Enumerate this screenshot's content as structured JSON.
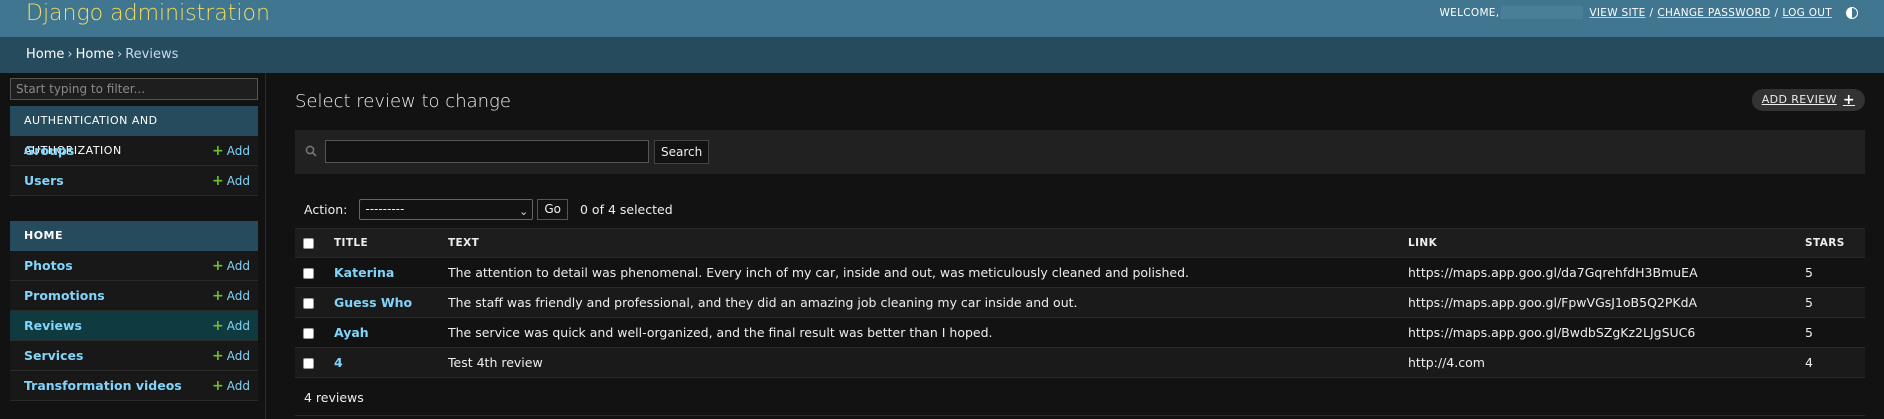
{
  "header": {
    "branding": "Django administration",
    "welcome": "WELCOME,",
    "view_site": "VIEW SITE",
    "change_password": "CHANGE PASSWORD",
    "log_out": "LOG OUT",
    "separator": "/"
  },
  "breadcrumbs": {
    "items": [
      "Home",
      "Home",
      "Reviews"
    ],
    "separator": "›"
  },
  "sidebar": {
    "filter_placeholder": "Start typing to filter...",
    "modules": [
      {
        "caption": "AUTHENTICATION AND AUTHORIZATION",
        "items": [
          {
            "label": "Groups",
            "add": "Add"
          },
          {
            "label": "Users",
            "add": "Add"
          }
        ]
      },
      {
        "caption": "HOME",
        "items": [
          {
            "label": "Photos",
            "add": "Add"
          },
          {
            "label": "Promotions",
            "add": "Add"
          },
          {
            "label": "Reviews",
            "add": "Add",
            "current": true
          },
          {
            "label": "Services",
            "add": "Add"
          },
          {
            "label": "Transformation videos",
            "add": "Add"
          }
        ]
      }
    ]
  },
  "main": {
    "title": "Select review to change",
    "add_button": "ADD REVIEW",
    "search_button": "Search",
    "search_value": "",
    "action_label": "Action:",
    "action_selected": "---------",
    "go_button": "Go",
    "selected_count": "0 of 4 selected",
    "columns": [
      "TITLE",
      "TEXT",
      "LINK",
      "STARS"
    ],
    "rows": [
      {
        "title": "Katerina",
        "text": "The attention to detail was phenomenal. Every inch of my car, inside and out, was meticulously cleaned and polished.",
        "link": "https://maps.app.goo.gl/da7GqrehfdH3BmuEA",
        "stars": "5"
      },
      {
        "title": "Guess Who",
        "text": "The staff was friendly and professional, and they did an amazing job cleaning my car inside and out.",
        "link": "https://maps.app.goo.gl/FpwVGsJ1oB5Q2PKdA",
        "stars": "5"
      },
      {
        "title": "Ayah",
        "text": "The service was quick and well-organized, and the final result was better than I hoped.",
        "link": "https://maps.app.goo.gl/BwdbSZgKz2LJgSUC6",
        "stars": "5"
      },
      {
        "title": "4",
        "text": "Test 4th review",
        "link": "http://4.com",
        "stars": "4"
      }
    ],
    "paginator": "4 reviews"
  },
  "colors": {
    "header_bg": "#417690",
    "branding": "#f5dd5d",
    "breadcrumb_bg": "#264b5d",
    "link": "#81d4fa",
    "add_icon": "#70bf2b",
    "current_row": "#0f3a3f"
  }
}
